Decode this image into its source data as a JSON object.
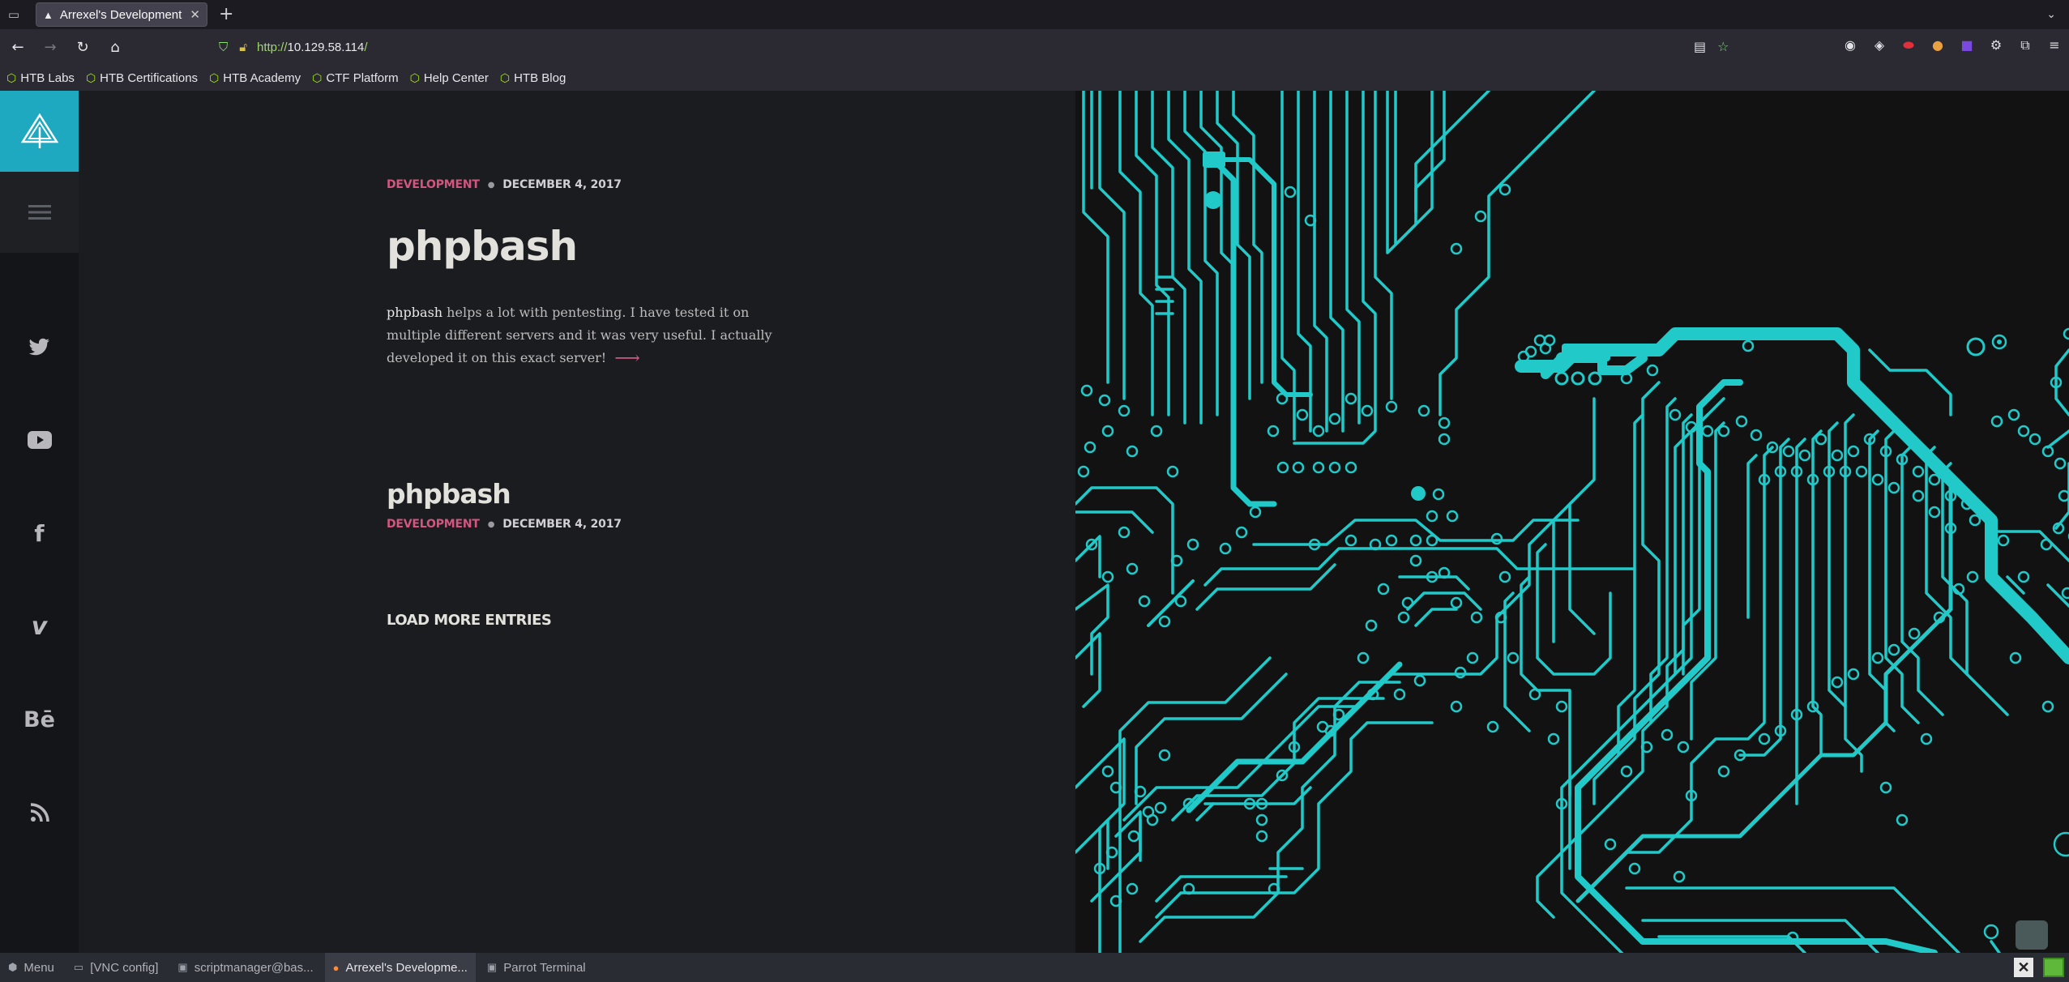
{
  "browser": {
    "tab_title": "Arrexel's Development Si",
    "url_scheme": "http://",
    "url_host": "10.129.58.114",
    "url_path": "/",
    "bookmarks": [
      "HTB Labs",
      "HTB Certifications",
      "HTB Academy",
      "CTF Platform",
      "Help Center",
      "HTB Blog"
    ]
  },
  "sidebar": {
    "social": [
      {
        "name": "twitter-icon",
        "glyph": "🐦"
      },
      {
        "name": "youtube-icon",
        "glyph": "▶"
      },
      {
        "name": "facebook-icon",
        "glyph": "f"
      },
      {
        "name": "vimeo-icon",
        "glyph": "v"
      },
      {
        "name": "behance-icon",
        "glyph": "Bē"
      },
      {
        "name": "rss-icon",
        "glyph": "⌁"
      }
    ]
  },
  "posts": {
    "featured": {
      "category": "DEVELOPMENT",
      "date": "DECEMBER 4, 2017",
      "title": "phpbash",
      "excerpt_lead": "phpbash",
      "excerpt_rest": " helps a lot with pentesting. I have tested it on multiple different servers and it was very useful. I actually developed it on this exact server!"
    },
    "second": {
      "title": "phpbash",
      "category": "DEVELOPMENT",
      "date": "DECEMBER 4, 2017"
    },
    "load_more": "LOAD MORE ENTRIES"
  },
  "taskbar": {
    "menu": "Menu",
    "items": [
      "[VNC config]",
      "scriptmanager@bas...",
      "Arrexel's Developme...",
      "Parrot Terminal"
    ]
  },
  "colors": {
    "accent": "#1fa9c1",
    "category": "#d3567f",
    "circuit": "#22c9c9"
  }
}
